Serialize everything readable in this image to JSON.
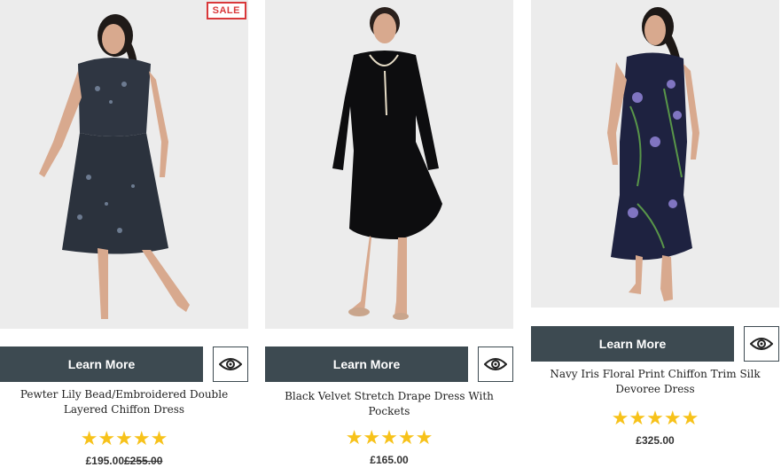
{
  "colors": {
    "button": "#3d4a51",
    "sale": "#d9383a",
    "star": "#f7c21a"
  },
  "products": [
    {
      "badge": "SALE",
      "cta": "Learn More",
      "quick_view_icon": "eye-icon",
      "title": "Pewter Lily Bead/Embroidered Double Layered Chiffon Dress",
      "rating": 5,
      "stars": "★★★★★",
      "price": "£195.00",
      "old_price": "£255.00"
    },
    {
      "cta": "Learn More",
      "quick_view_icon": "eye-icon",
      "title": "Black Velvet Stretch Drape Dress With Pockets",
      "rating": 5,
      "stars": "★★★★★",
      "price": "£165.00"
    },
    {
      "cta": "Learn More",
      "quick_view_icon": "eye-icon",
      "title": "Navy Iris Floral Print Chiffon Trim Silk Devoree Dress",
      "rating": 5,
      "stars": "★★★★★",
      "price": "£325.00"
    }
  ]
}
